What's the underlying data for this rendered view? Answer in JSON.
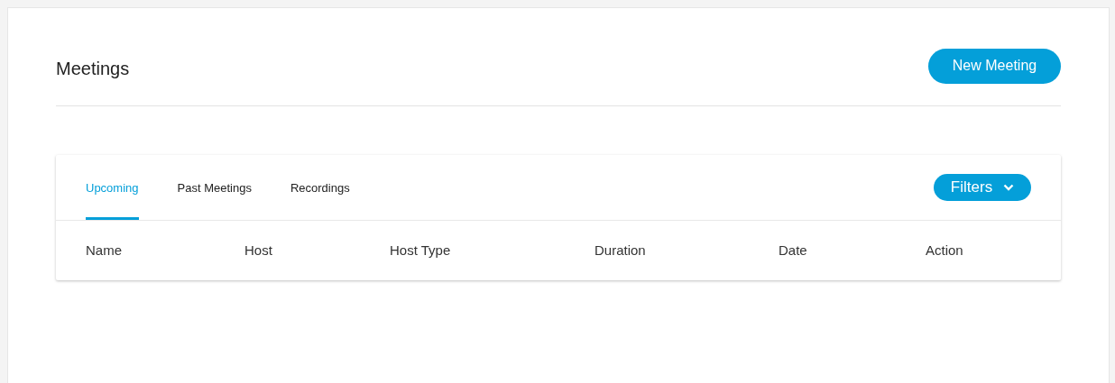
{
  "page": {
    "title": "Meetings"
  },
  "new_meeting_button": {
    "label": "New Meeting"
  },
  "tabs": [
    {
      "label": "Upcoming",
      "selected": true
    },
    {
      "label": "Past Meetings",
      "selected": false
    },
    {
      "label": "Recordings",
      "selected": false
    }
  ],
  "filters_button": {
    "label": "Filters"
  },
  "table": {
    "columns": [
      "Name",
      "Host",
      "Host Type",
      "Duration",
      "Date",
      "Action"
    ]
  }
}
